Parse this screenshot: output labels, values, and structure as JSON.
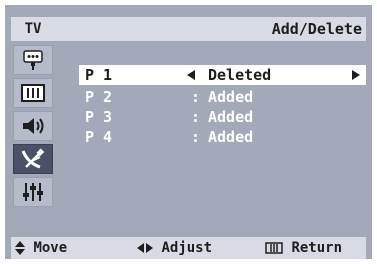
{
  "header": {
    "mode_label": "TV",
    "title": "Add/Delete"
  },
  "sidebar": {
    "items": [
      {
        "icon": "antenna-icon"
      },
      {
        "icon": "picture-icon"
      },
      {
        "icon": "sound-icon"
      },
      {
        "icon": "channel-icon",
        "active": true
      },
      {
        "icon": "setup-icon"
      }
    ]
  },
  "channels": [
    {
      "label": "P 1",
      "status": "Deleted",
      "selected": true
    },
    {
      "label": "P 2",
      "separator": ":",
      "status": "Added"
    },
    {
      "label": "P 3",
      "separator": ":",
      "status": "Added"
    },
    {
      "label": "P 4",
      "separator": ":",
      "status": "Added"
    }
  ],
  "footer": {
    "move_label": "Move",
    "adjust_label": "Adjust",
    "return_label": "Return"
  },
  "colors": {
    "panel": "#a4a9b9",
    "bar": "#d8dbe3",
    "selected_row": "#ffffff",
    "active_icon": "#4a5068"
  }
}
